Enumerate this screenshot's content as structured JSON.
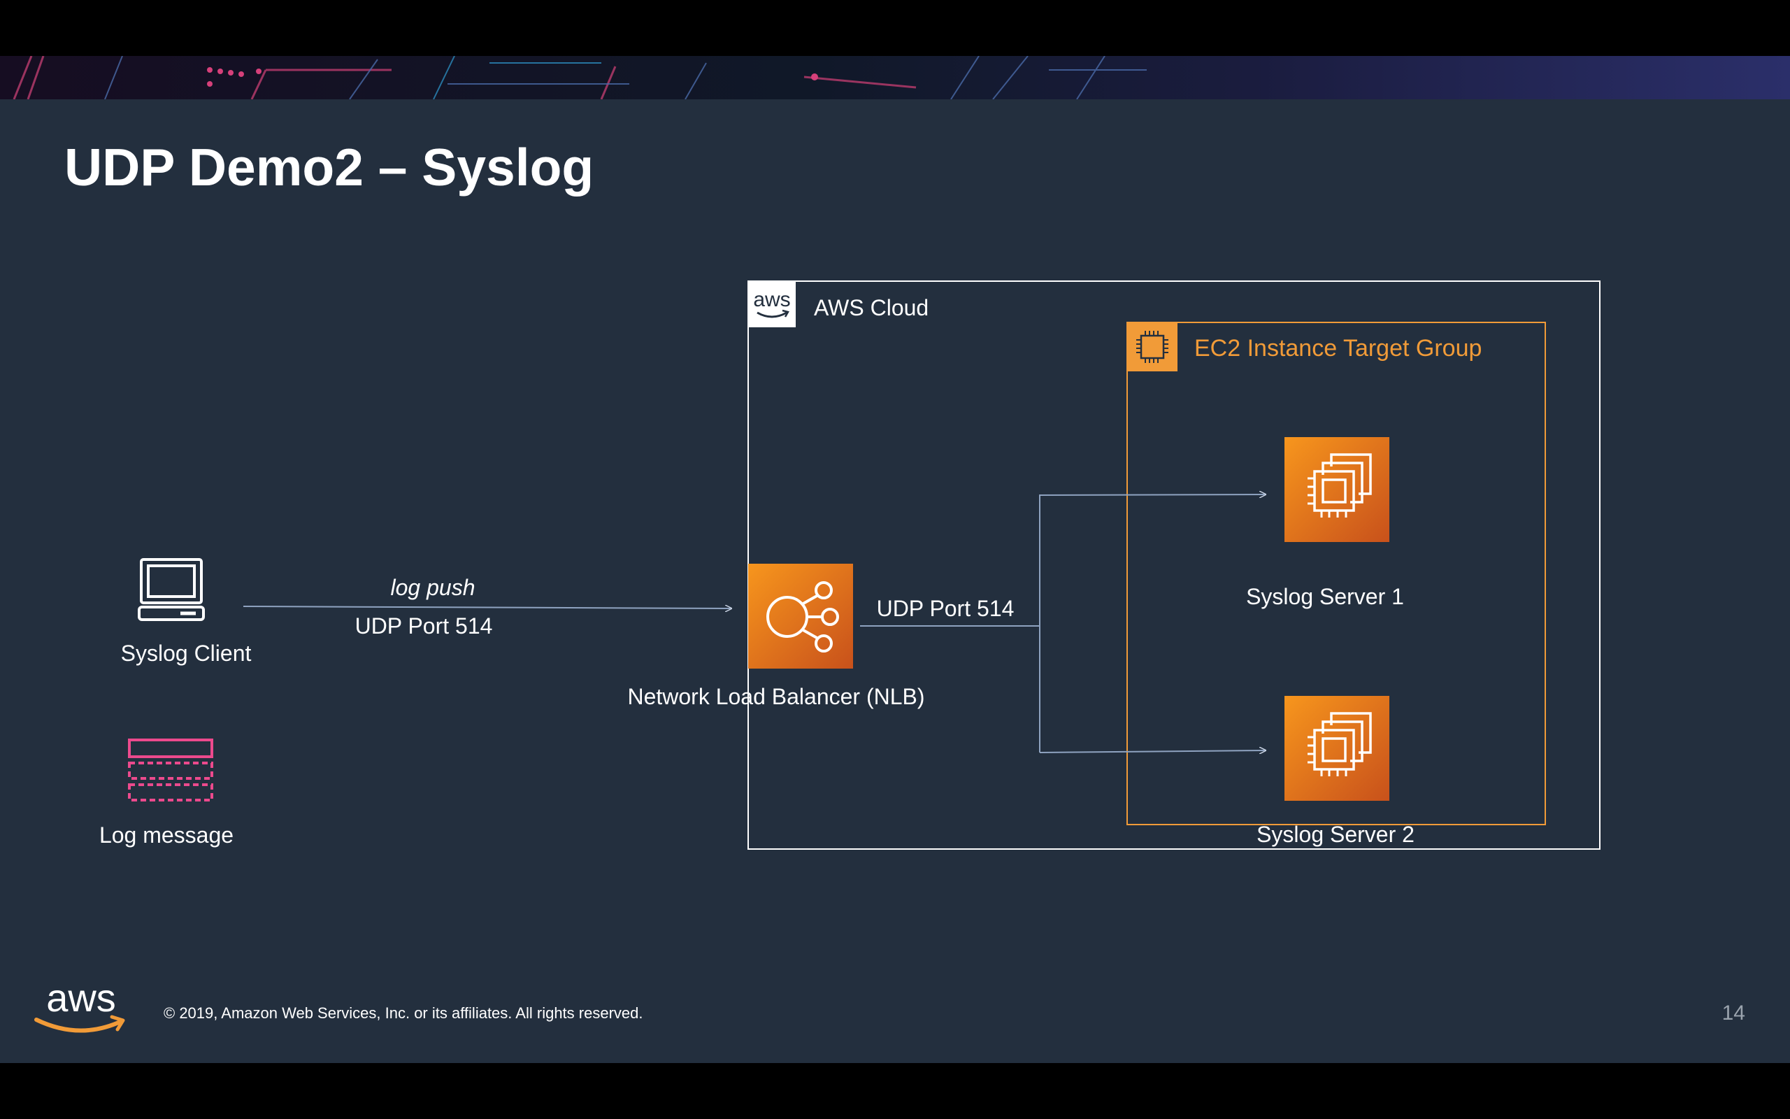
{
  "slide": {
    "title": "UDP Demo2 – Syslog",
    "footer": "© 2019, Amazon Web Services, Inc. or its affiliates. All rights reserved.",
    "page_number": "14",
    "logo_text": "aws"
  },
  "diagram": {
    "client_label": "Syslog Client",
    "log_message_label": "Log message",
    "edge_log_push_label": "log push",
    "edge_client_port_label": "UDP Port 514",
    "nlb_label": "Network Load Balancer (NLB)",
    "edge_nlb_port_label": "UDP Port 514",
    "cloud_label": "AWS Cloud",
    "cloud_badge_text": "aws",
    "target_group_label": "EC2 Instance Target Group",
    "server1_label": "Syslog Server 1",
    "server2_label": "Syslog Server 2"
  },
  "colors": {
    "slide_background": "#232f3e",
    "aws_orange": "#f19b38",
    "ec2_gradient_top": "#f7961d",
    "ec2_gradient_bottom": "#c8511b",
    "log_message_pink": "#ec4a8d",
    "connector": "#8fa3c0"
  },
  "icons": [
    "laptop-icon",
    "log-message-icon",
    "nlb-icon",
    "ec2-chip-icon",
    "ec2-instance-icon",
    "aws-logo"
  ]
}
